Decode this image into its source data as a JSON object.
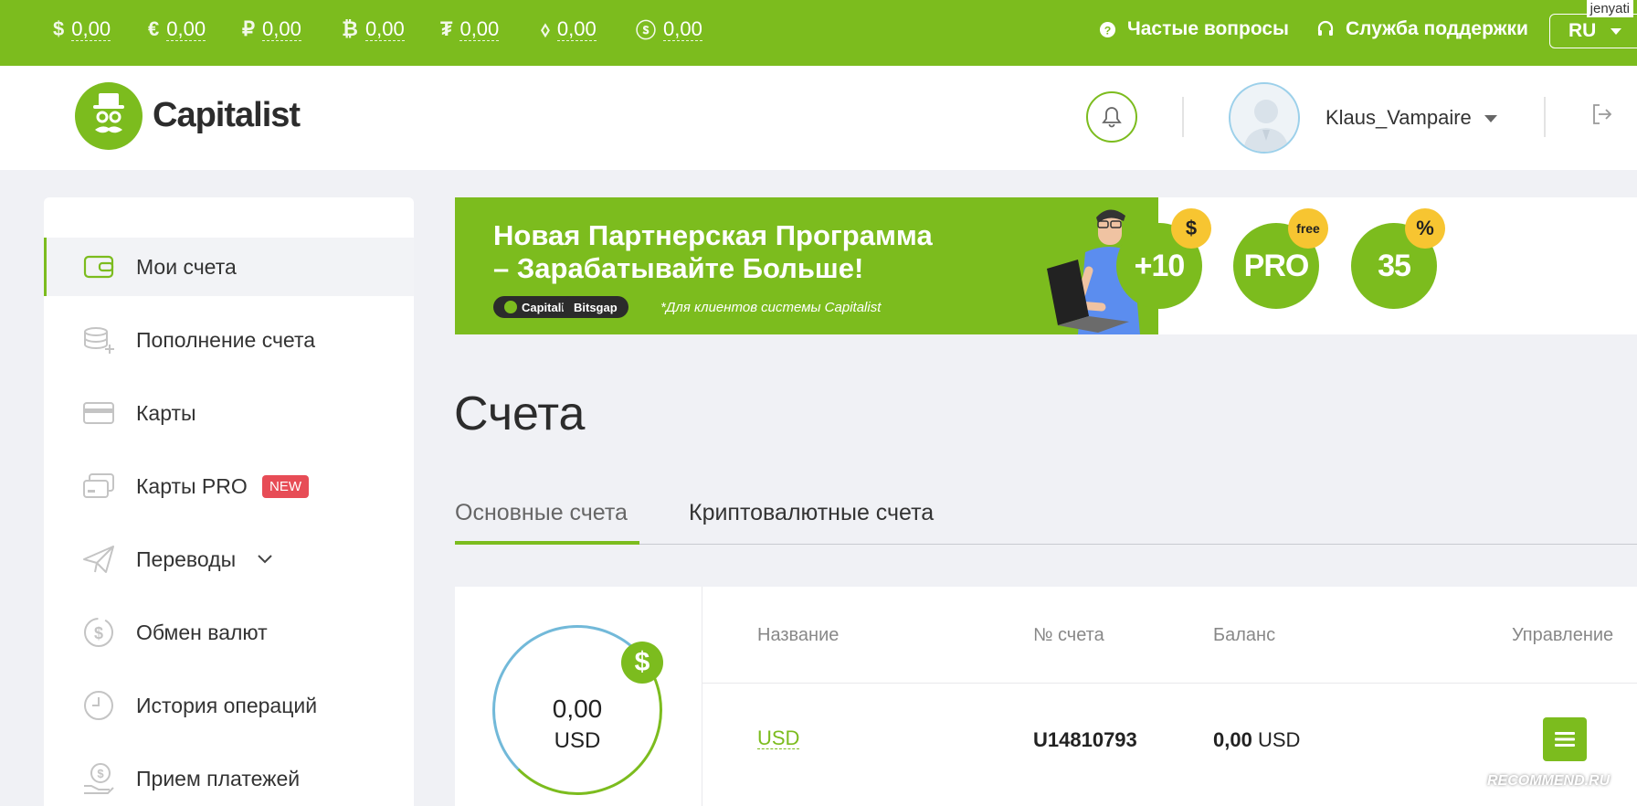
{
  "topbar": {
    "balances": [
      {
        "symbol": "$",
        "value": "0,00"
      },
      {
        "symbol": "€",
        "value": "0,00"
      },
      {
        "symbol": "₽",
        "value": "0,00"
      },
      {
        "symbol": "₿",
        "value": "0,00"
      },
      {
        "symbol": "₮",
        "value": "0,00"
      },
      {
        "symbol": "⬨",
        "value": "0,00"
      },
      {
        "symbol": "ⓢ",
        "value": "0,00"
      }
    ],
    "faq_label": "Частые вопросы",
    "support_label": "Служба поддержки",
    "language": "RU",
    "watermark_user": "jenyati"
  },
  "header": {
    "logo_text": "Capitalist",
    "username": "Klaus_Vampaire"
  },
  "sidebar": {
    "items": [
      {
        "label": "Мои счета",
        "icon": "wallet-icon"
      },
      {
        "label": "Пополнение счета",
        "icon": "coins-plus-icon"
      },
      {
        "label": "Карты",
        "icon": "card-icon"
      },
      {
        "label": "Карты PRO",
        "icon": "cards-pro-icon",
        "badge": "NEW"
      },
      {
        "label": "Переводы",
        "icon": "paper-plane-icon"
      },
      {
        "label": "Обмен валют",
        "icon": "exchange-icon"
      },
      {
        "label": "История операций",
        "icon": "clock-icon"
      },
      {
        "label": "Прием платежей",
        "icon": "payment-hand-icon"
      }
    ]
  },
  "banner": {
    "title_line1": "Новая Партнерская Программа",
    "title_line2": "– Зарабатывайте Больше!",
    "pill1": "Capitalist",
    "pill2": "Bitsgap",
    "note": "*Для клиентов системы Capitalist",
    "promos": [
      {
        "text": "+10",
        "badge": "$"
      },
      {
        "text": "PRO",
        "badge": "free"
      },
      {
        "text": "35",
        "badge": "%"
      }
    ]
  },
  "main": {
    "title": "Счета",
    "tabs": [
      {
        "label": "Основные счета",
        "active": true
      },
      {
        "label": "Криптовалютные счета",
        "active": false
      }
    ]
  },
  "accounts": {
    "summary_amount": "0,00",
    "summary_currency": "USD",
    "summary_badge": "$",
    "columns": [
      "Название",
      "№ счета",
      "Баланс",
      "Управление"
    ],
    "rows": [
      {
        "name": "USD",
        "number": "U14810793",
        "balance_amount": "0,00",
        "balance_currency": "USD"
      }
    ]
  },
  "watermark_bottom": "RECOMMEND.RU",
  "colors": {
    "accent": "#7cbc1e",
    "badge_new": "#e74c56",
    "promo_badge": "#f7c531"
  }
}
